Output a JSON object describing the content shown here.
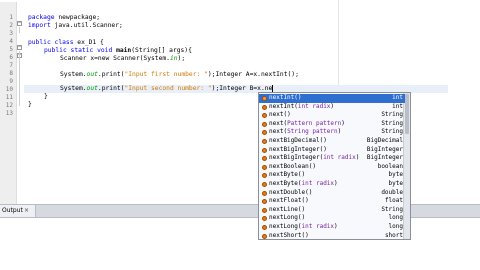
{
  "editor": {
    "line_numbers": [
      "1",
      "2",
      "3",
      "4",
      "5",
      "6",
      "7",
      "8",
      "9",
      "10",
      "11",
      "12",
      "13"
    ],
    "lines": {
      "l1": {
        "kw": "package",
        "rest": " newpackage;"
      },
      "l2": {
        "kw": "import",
        "rest": " java.util.Scanner;"
      },
      "l4": {
        "kw1": "public",
        "kw2": "class",
        "rest": " ex_D1 {"
      },
      "l5": {
        "kw1": "public",
        "kw2": "static",
        "kw3": "void",
        "name": "main",
        "rest": "(String[] args){"
      },
      "l6": {
        "text": "Scanner x=new Scanner(System.",
        "field": "in",
        "end": ");"
      },
      "l8a": {
        "text": "System.",
        "field": "out",
        "call": ".print(",
        "str": "\"Input first number: \"",
        "rest": ");Integer A=x.nextInt();"
      },
      "l8b": {
        "text": "System.",
        "field": "out",
        "call": ".print(",
        "str": "\"Input second number: \"",
        "rest": ");Integer B=x.ne"
      },
      "l9": {
        "text": "}"
      },
      "l10": {
        "text": "}"
      }
    }
  },
  "output": {
    "tab_label": "Output",
    "close_glyph": "×"
  },
  "completion": {
    "items": [
      {
        "name": "nextInt",
        "params": "",
        "type": "int",
        "selected": true
      },
      {
        "name": "nextInt",
        "params": "int radix",
        "type": "int"
      },
      {
        "name": "next",
        "params": "",
        "type": "String"
      },
      {
        "name": "next",
        "params": "Pattern pattern",
        "type": "String"
      },
      {
        "name": "next",
        "params": "String pattern",
        "type": "String"
      },
      {
        "name": "nextBigDecimal",
        "params": "",
        "type": "BigDecimal"
      },
      {
        "name": "nextBigInteger",
        "params": "",
        "type": "BigInteger"
      },
      {
        "name": "nextBigInteger",
        "params": "int radix",
        "type": "BigInteger"
      },
      {
        "name": "nextBoolean",
        "params": "",
        "type": "boolean"
      },
      {
        "name": "nextByte",
        "params": "",
        "type": "byte"
      },
      {
        "name": "nextByte",
        "params": "int radix",
        "type": "byte"
      },
      {
        "name": "nextDouble",
        "params": "",
        "type": "double"
      },
      {
        "name": "nextFloat",
        "params": "",
        "type": "float"
      },
      {
        "name": "nextLine",
        "params": "",
        "type": "String"
      },
      {
        "name": "nextLong",
        "params": "",
        "type": "long"
      },
      {
        "name": "nextLong",
        "params": "int radix",
        "type": "long"
      },
      {
        "name": "nextShort",
        "params": "",
        "type": "short"
      }
    ]
  }
}
